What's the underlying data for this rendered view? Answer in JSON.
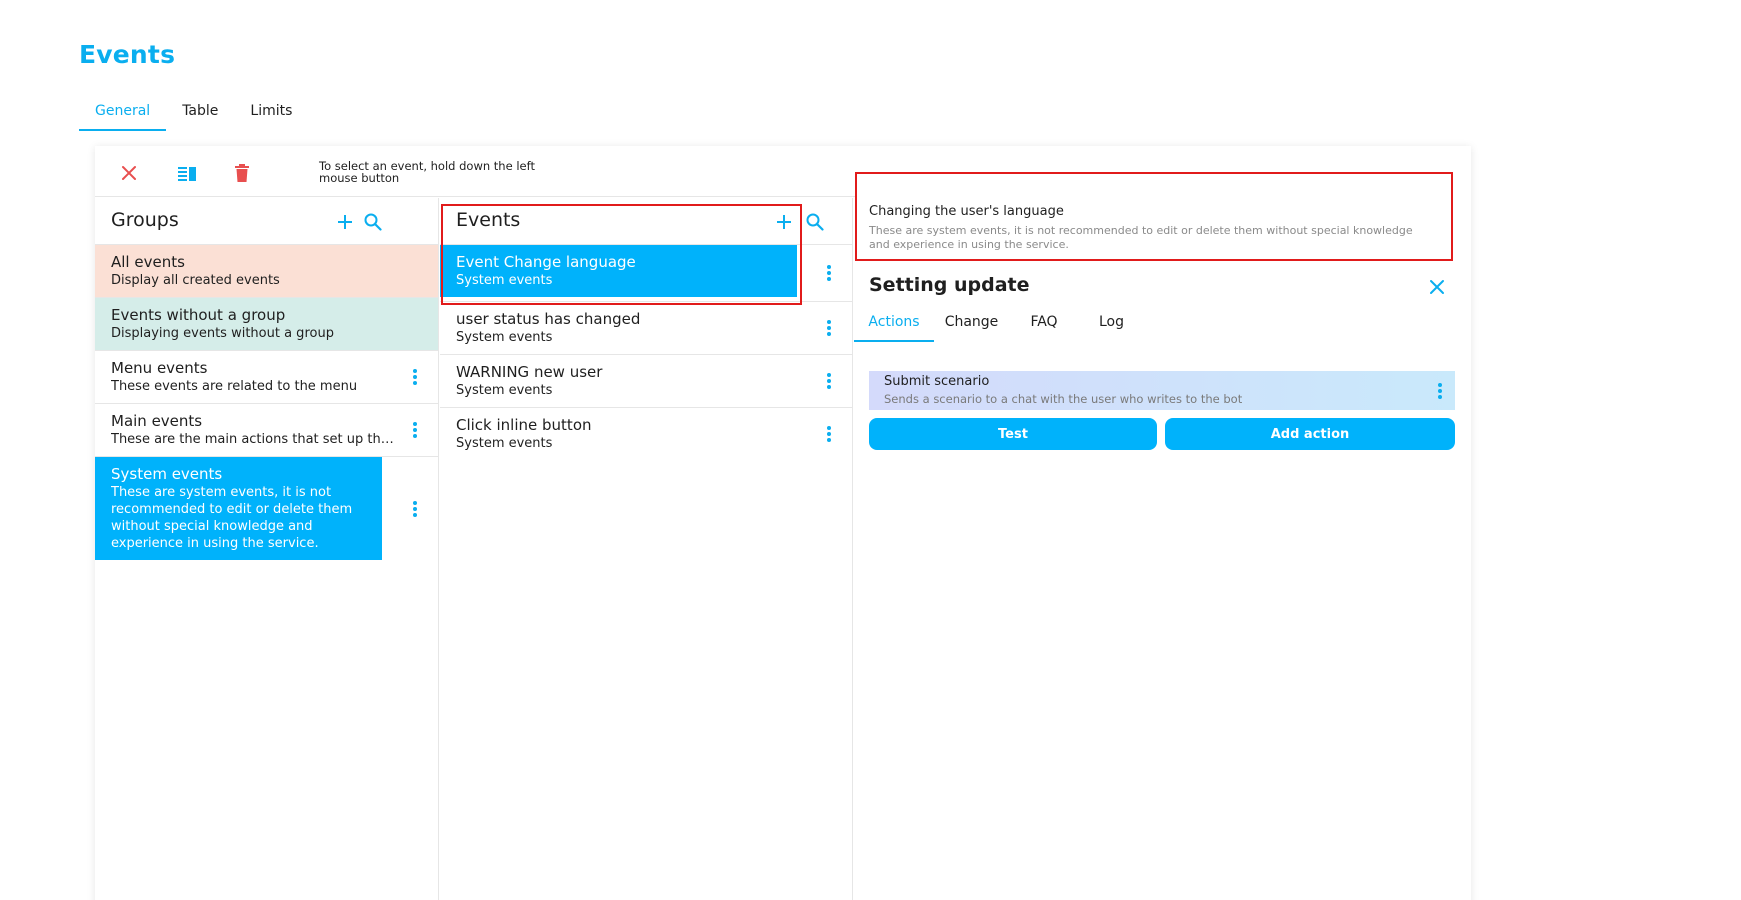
{
  "page": {
    "title": "Events"
  },
  "tabs": [
    {
      "label": "General",
      "active": true
    },
    {
      "label": "Table",
      "active": false
    },
    {
      "label": "Limits",
      "active": false
    }
  ],
  "toolbar": {
    "hint": "To select an event, hold down the left mouse button"
  },
  "groups": {
    "title": "Groups",
    "items": [
      {
        "title": "All events",
        "subtitle": "Display all created events"
      },
      {
        "title": "Events without a group",
        "subtitle": "Displaying events without a group"
      },
      {
        "title": "Menu events",
        "subtitle": "These events are related to the menu"
      },
      {
        "title": "Main events",
        "subtitle": "These are the main actions that set up the bot"
      },
      {
        "title": "System events",
        "subtitle": "These are system events, it is not recommended to edit or delete them without special knowledge and experience in using the service."
      }
    ]
  },
  "events": {
    "title": "Events",
    "items": [
      {
        "title": "Event Change language",
        "subtitle": "System events"
      },
      {
        "title": "user status has changed",
        "subtitle": "System events"
      },
      {
        "title": "WARNING new user",
        "subtitle": "System events"
      },
      {
        "title": "Click inline button",
        "subtitle": "System events"
      }
    ]
  },
  "details": {
    "info_title": "Changing the user's language",
    "info_subtitle": "These are system events, it is not recommended to edit or delete them without special knowledge and experience in using the service.",
    "panel_title": "Setting update",
    "sub_tabs": [
      {
        "label": "Actions",
        "active": true
      },
      {
        "label": "Change",
        "active": false
      },
      {
        "label": "FAQ",
        "active": false
      },
      {
        "label": "Log",
        "active": false
      }
    ],
    "action": {
      "title": "Submit scenario",
      "subtitle": "Sends a scenario to a chat with the user who writes to the bot"
    },
    "test_label": "Test",
    "add_action_label": "Add action"
  },
  "colors": {
    "accent": "#0aaeef",
    "selected": "#00b2fb",
    "all_events_bg": "#fbe0d5",
    "no_group_bg": "#d5ede9",
    "danger": "#e84f4f",
    "highlight_box": "#e11b1b"
  },
  "icons": {
    "toolbar": [
      "close-icon",
      "columns-icon",
      "trash-icon"
    ],
    "column_header": [
      "plus-icon",
      "search-icon"
    ],
    "row": "more-vertical-icon"
  }
}
